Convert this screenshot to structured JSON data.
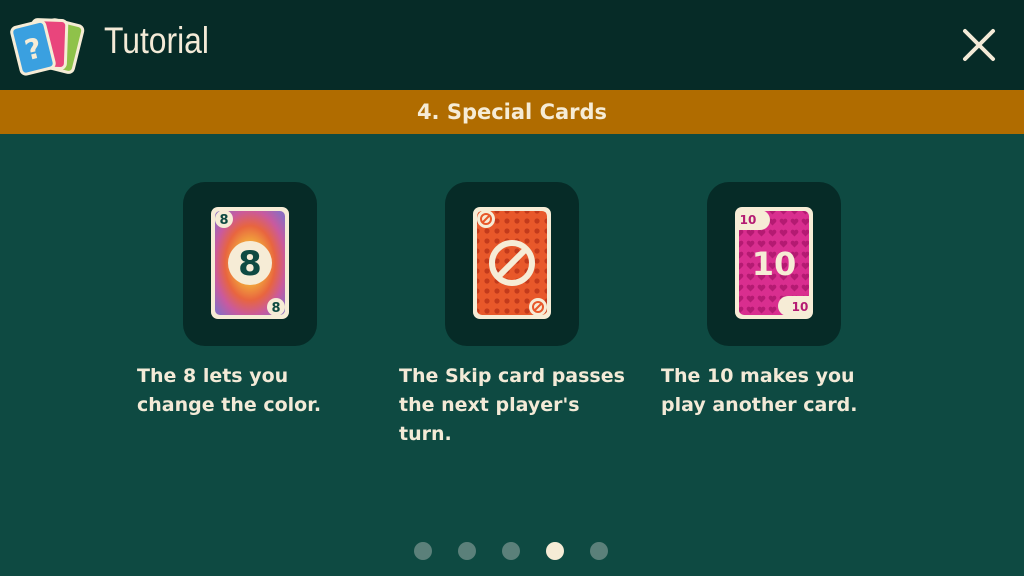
{
  "header": {
    "title": "Tutorial",
    "logo_icon": "cards-question-icon",
    "close_icon": "close-icon"
  },
  "section": {
    "title": "4. Special Cards"
  },
  "cards": [
    {
      "name": "eight",
      "face_value": "8",
      "corner_value": "8",
      "description": "The 8 lets you change the color."
    },
    {
      "name": "skip",
      "face_value": "skip",
      "corner_value": "skip",
      "description": "The Skip card passes the next player's turn."
    },
    {
      "name": "ten",
      "face_value": "10",
      "corner_value": "10",
      "description": "The 10 makes you play another card."
    }
  ],
  "pagination": {
    "total": 5,
    "current": 4
  },
  "colors": {
    "background": "#0e4a42",
    "header": "#062b27",
    "banner": "#b06c00",
    "text": "#f3ead7"
  }
}
